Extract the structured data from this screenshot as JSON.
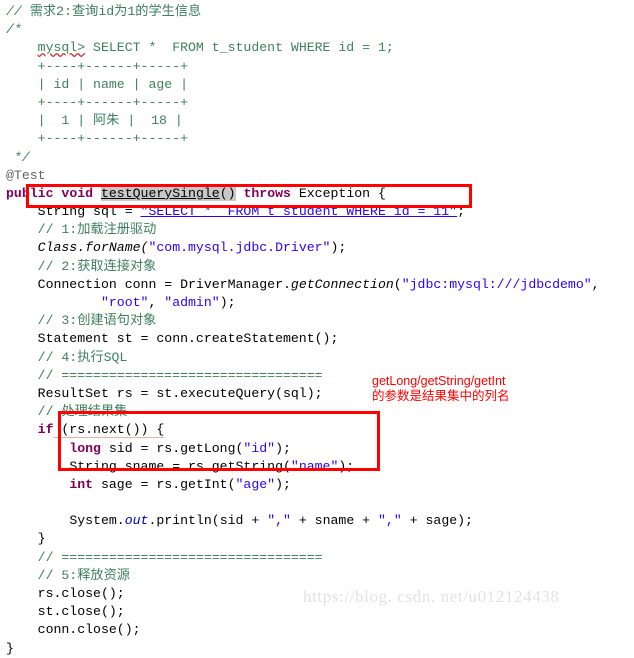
{
  "editor": {
    "language": "java",
    "background": "#ffffff",
    "colors": {
      "comment": "#3f7f5f",
      "keyword": "#7f0055",
      "string": "#2a00ff",
      "annotation": "#646464",
      "field": "#0000c0",
      "plain": "#000000",
      "highlight": "#c8c8c8",
      "annotation_red": "#ff0000",
      "watermark": "#e2e2e2"
    }
  },
  "code": {
    "line01": {
      "comment_slashes": "// ",
      "text": "需求2:查询id为1的学生信息"
    },
    "line02": {
      "text": "/*"
    },
    "line03": {
      "indent": "    ",
      "prompt": "mysql>",
      "sql": " SELECT *  FROM t_student WHERE id = 1;"
    },
    "line04": {
      "indent": "    ",
      "text": "+----+------+-----+"
    },
    "line05": {
      "indent": "    ",
      "text": "| id | name | age |"
    },
    "line06": {
      "indent": "    ",
      "text": "+----+------+-----+"
    },
    "line07": {
      "indent": "    ",
      "text": "|  1 | 阿朱 |  18 |"
    },
    "line08": {
      "indent": "    ",
      "text": "+----+------+-----+"
    },
    "line09": {
      "text": " */"
    },
    "line10": {
      "text": "@Test"
    },
    "line11": {
      "kw_public": "public",
      "kw_void": "void",
      "method": "testQuerySingle",
      "params": "()",
      "kw_throws": "throws",
      "exception": "Exception",
      "brace": "{"
    },
    "line12": {
      "indent": "    ",
      "type": "String",
      "var": " sql = ",
      "string": "\"SELECT *  FROM t_student WHERE id = 11\"",
      "semi": ";"
    },
    "line13": {
      "indent": "    ",
      "comment": "// 1:加载注册驱动"
    },
    "line14": {
      "indent": "    ",
      "call": "Class.forName(",
      "string": "\"com.mysql.jdbc.Driver\"",
      "tail": ");"
    },
    "line15": {
      "indent": "    ",
      "comment": "// 2:获取连接对象"
    },
    "line16": {
      "indent": "    ",
      "pre": "Connection conn = DriverManager.",
      "method": "getConnection",
      "open": "(",
      "string": "\"jdbc:mysql:///jdbcdemo\"",
      "tail": ","
    },
    "line17": {
      "indent": "            ",
      "string1": "\"root\"",
      "sep": ", ",
      "string2": "\"admin\"",
      "tail": ");"
    },
    "line18": {
      "indent": "    ",
      "comment": "// 3:创建语句对象"
    },
    "line19": {
      "indent": "    ",
      "text": "Statement st = conn.createStatement();"
    },
    "line20": {
      "indent": "    ",
      "comment": "// 4:执行SQL"
    },
    "line21": {
      "indent": "    ",
      "comment": "// ================================="
    },
    "line22": {
      "indent": "    ",
      "text": "ResultSet rs = st.executeQuery(sql);"
    },
    "line23": {
      "indent": "    ",
      "comment": "// 处理结果集"
    },
    "line24": {
      "indent": "    ",
      "kw_if": "if",
      "cond": " (rs.next()) {"
    },
    "line25": {
      "indent": "        ",
      "kw": "long",
      "pre": " sid = rs.getLong(",
      "string": "\"id\"",
      "tail": ");"
    },
    "line26": {
      "indent": "        ",
      "kw": "String",
      "pre": " sname = rs.getString(",
      "string": "\"name\"",
      "tail": ");"
    },
    "line27": {
      "indent": "        ",
      "kw": "int",
      "pre": " sage = rs.getInt(",
      "string": "\"age\"",
      "tail": ");"
    },
    "line28": {
      "text": ""
    },
    "line29": {
      "indent": "        ",
      "pre": "System.",
      "field": "out",
      "mid": ".println(sid + ",
      "string1": "\",\"",
      "mid2": " + sname + ",
      "string2": "\",\"",
      "tail": " + sage);"
    },
    "line30": {
      "indent": "    ",
      "text": "}"
    },
    "line31": {
      "indent": "    ",
      "comment": "// ================================="
    },
    "line32": {
      "indent": "    ",
      "comment": "// 5:释放资源"
    },
    "line33": {
      "indent": "    ",
      "text": "rs.close();"
    },
    "line34": {
      "indent": "    ",
      "text": "st.close();"
    },
    "line35": {
      "indent": "    ",
      "text": "conn.close();"
    },
    "line36": {
      "text": "}"
    }
  },
  "annotations": {
    "getters_note_line1": "getLong/getString/getInt",
    "getters_note_line2": "的参数是结果集中的列名",
    "box_sql_label": "highlighted-sql-statement",
    "box_getters_label": "highlighted-getter-calls"
  },
  "watermark": {
    "text": "https://blog. csdn. net/u012124438"
  }
}
